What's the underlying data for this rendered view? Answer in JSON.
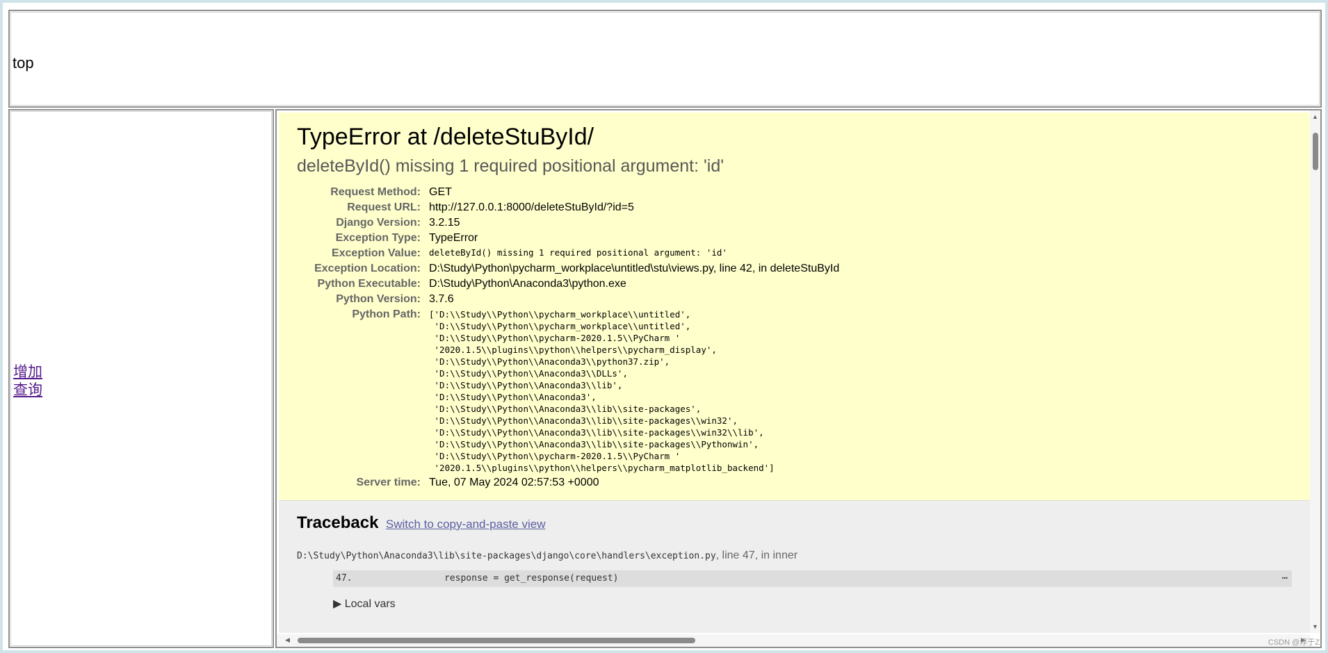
{
  "top_frame": {
    "text": "top"
  },
  "left_frame": {
    "links": [
      "增加",
      "查询"
    ]
  },
  "error": {
    "title": "TypeError at /deleteStuById/",
    "message": "deleteById() missing 1 required positional argument: 'id'",
    "meta": [
      {
        "label": "Request Method:",
        "value": "GET"
      },
      {
        "label": "Request URL:",
        "value": "http://127.0.0.1:8000/deleteStuById/?id=5"
      },
      {
        "label": "Django Version:",
        "value": "3.2.15"
      },
      {
        "label": "Exception Type:",
        "value": "TypeError"
      },
      {
        "label": "Exception Value:",
        "value": "deleteById() missing 1 required positional argument: 'id'"
      },
      {
        "label": "Exception Location:",
        "value": "D:\\Study\\Python\\pycharm_workplace\\untitled\\stu\\views.py, line 42, in deleteStuById"
      },
      {
        "label": "Python Executable:",
        "value": "D:\\Study\\Python\\Anaconda3\\python.exe"
      },
      {
        "label": "Python Version:",
        "value": "3.7.6"
      }
    ],
    "python_path_label": "Python Path:",
    "python_path": "['D:\\\\Study\\\\Python\\\\pycharm_workplace\\\\untitled',\n 'D:\\\\Study\\\\Python\\\\pycharm_workplace\\\\untitled',\n 'D:\\\\Study\\\\Python\\\\pycharm-2020.1.5\\\\PyCharm '\n '2020.1.5\\\\plugins\\\\python\\\\helpers\\\\pycharm_display',\n 'D:\\\\Study\\\\Python\\\\Anaconda3\\\\python37.zip',\n 'D:\\\\Study\\\\Python\\\\Anaconda3\\\\DLLs',\n 'D:\\\\Study\\\\Python\\\\Anaconda3\\\\lib',\n 'D:\\\\Study\\\\Python\\\\Anaconda3',\n 'D:\\\\Study\\\\Python\\\\Anaconda3\\\\lib\\\\site-packages',\n 'D:\\\\Study\\\\Python\\\\Anaconda3\\\\lib\\\\site-packages\\\\win32',\n 'D:\\\\Study\\\\Python\\\\Anaconda3\\\\lib\\\\site-packages\\\\win32\\\\lib',\n 'D:\\\\Study\\\\Python\\\\Anaconda3\\\\lib\\\\site-packages\\\\Pythonwin',\n 'D:\\\\Study\\\\Python\\\\pycharm-2020.1.5\\\\PyCharm '\n '2020.1.5\\\\plugins\\\\python\\\\helpers\\\\pycharm_matplotlib_backend']",
    "server_time_label": "Server time:",
    "server_time": "Tue, 07 May 2024 02:57:53 +0000"
  },
  "traceback": {
    "heading": "Traceback",
    "switch_link": "Switch to copy-and-paste view",
    "frame_path": "D:\\Study\\Python\\Anaconda3\\lib\\site-packages\\django\\core\\handlers\\exception.py",
    "frame_info": ", line 47, in inner",
    "line_no": "47.",
    "code": "response = get_response(request)",
    "ellipsis": "…",
    "local_vars": "▶ Local vars"
  },
  "watermark": "CSDN @浮于Z"
}
